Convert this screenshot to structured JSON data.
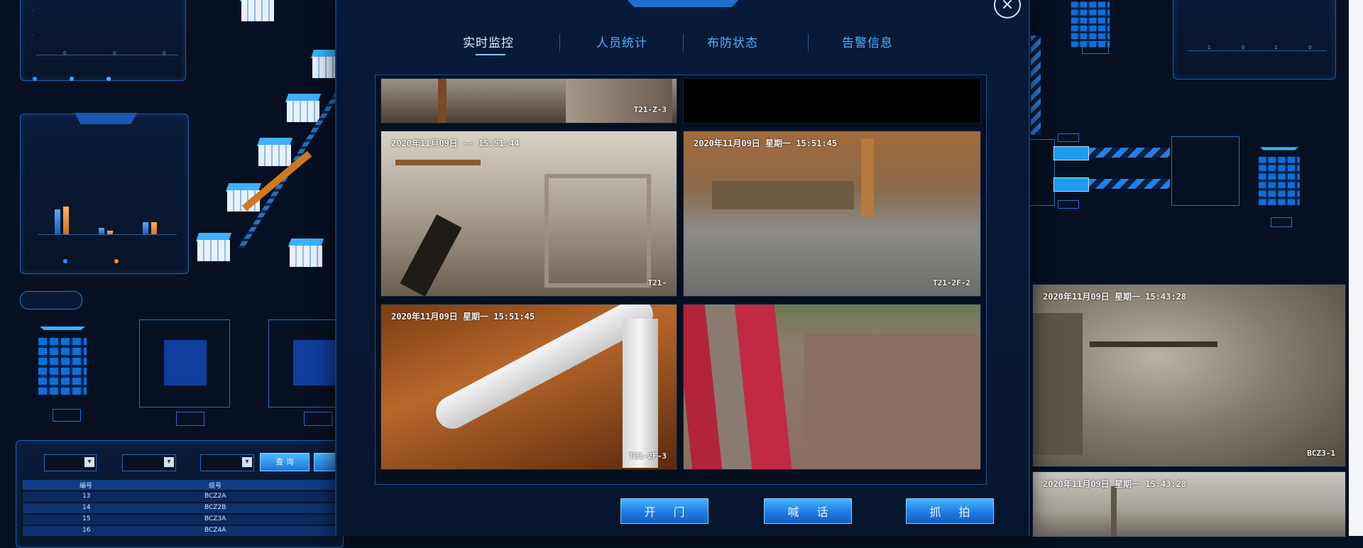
{
  "left_top_chart": {
    "type": "bar",
    "legend": [
      "",
      "",
      ""
    ]
  },
  "left_mid_chart": {
    "title": "",
    "legend": [
      "",
      ""
    ]
  },
  "left_section_button": "",
  "left_filter": {
    "label1": "",
    "label2": "",
    "label3": "",
    "query_button": "查 询"
  },
  "left_table": {
    "headers": [
      "编号",
      "缆号"
    ],
    "rows": [
      {
        "id": "13",
        "code": "BCZ2A"
      },
      {
        "id": "14",
        "code": "BCZ2B"
      },
      {
        "id": "15",
        "code": "BCZ3A"
      },
      {
        "id": "16",
        "code": "BCZ4A"
      }
    ]
  },
  "modal": {
    "tabs": [
      "实时监控",
      "人员统计",
      "布防状态",
      "告警信息"
    ],
    "active_tab": 0,
    "cameras": [
      {
        "stamp": "",
        "id": "T21-Z-3"
      },
      {
        "stamp": "",
        "id": ""
      },
      {
        "stamp": "2020年11月09日 -- 15:51:44",
        "id": "T21-"
      },
      {
        "stamp": "2020年11月09日 星期一 15:51:45",
        "id": "T21-2F-2"
      },
      {
        "stamp": "2020年11月09日 星期一 15:51:45",
        "id": "T21-2F-3"
      },
      {
        "stamp": "",
        "id": ""
      }
    ],
    "actions": [
      "开 门",
      "喊 话",
      "抓 拍"
    ],
    "close_icon": "×"
  },
  "right_cameras": [
    {
      "stamp": "2020年11月09日 星期一 15:43:28",
      "id": "BCZ3-1"
    },
    {
      "stamp": "2020年11月09日 星期一 15:43:28",
      "id": ""
    }
  ],
  "colors": {
    "background": "#061022",
    "accent": "#2f8fff",
    "orange": "#f09030",
    "button": "#2a8cf0"
  }
}
